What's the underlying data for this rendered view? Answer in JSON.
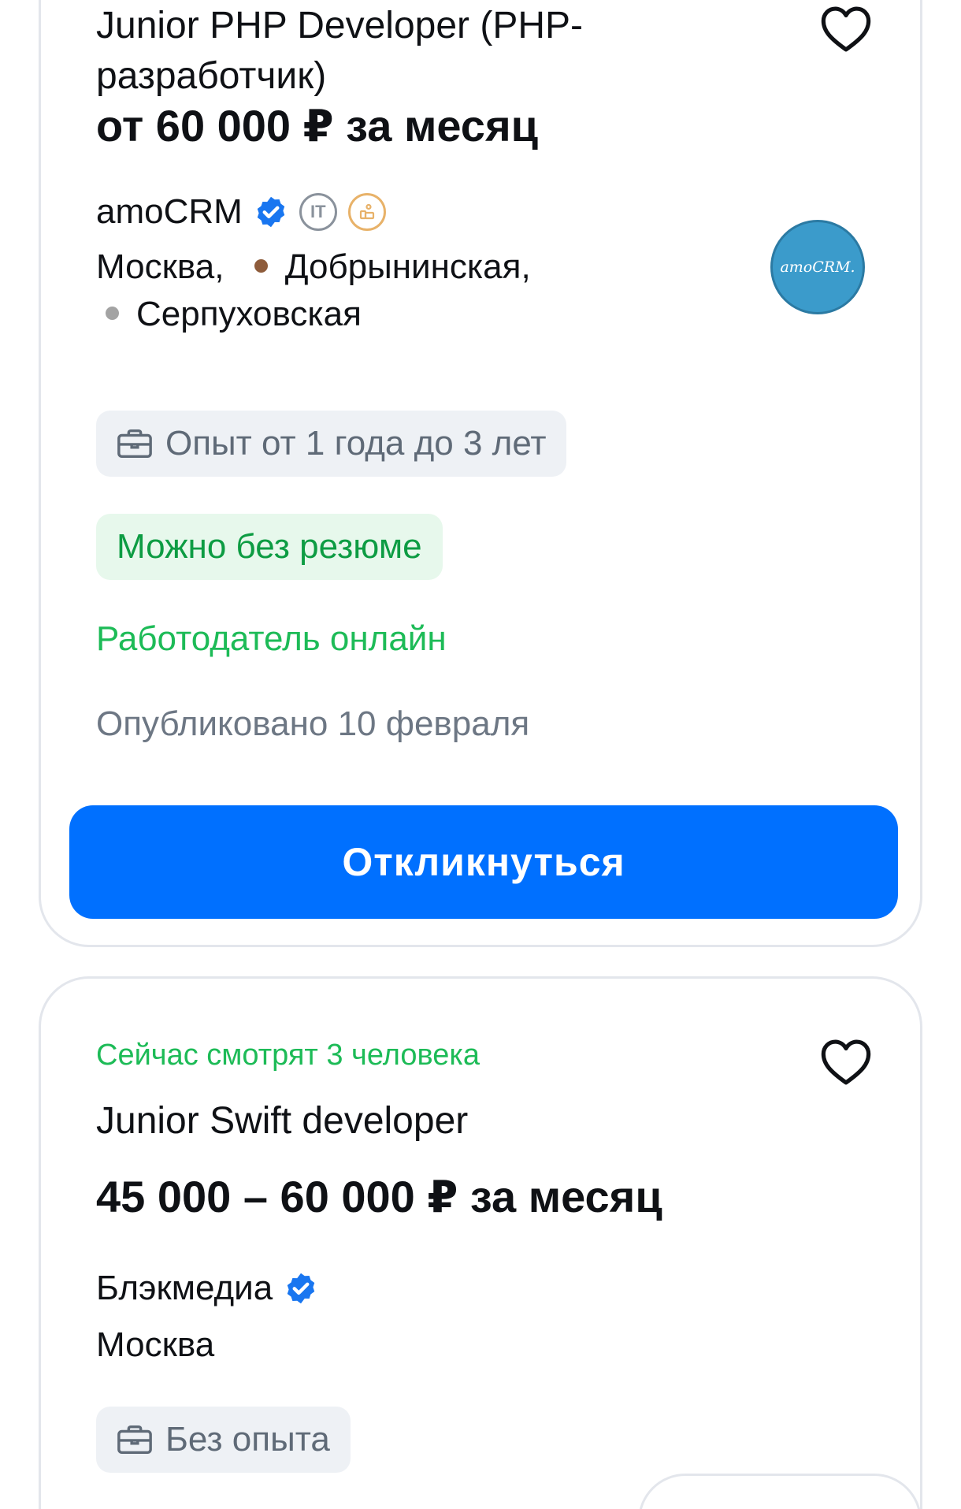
{
  "vacancies": [
    {
      "title": "Junior PHP Developer (PHP-разработчик)",
      "salary": "от 60 000 ₽ за месяц",
      "company": "amoCRM",
      "company_logo_text": "amoCRM.",
      "badges": [
        "verified-icon",
        "it-accreditation-icon",
        "trusted-employer-icon"
      ],
      "location": {
        "city": "Москва,",
        "metro": [
          {
            "name": "Добрынинская,",
            "color": "#8e5c3b"
          },
          {
            "name": "Серпуховская",
            "color": "#a3a3a3"
          }
        ]
      },
      "experience": "Опыт от 1 года до 3 лет",
      "no_resume": "Можно без резюме",
      "employer_online": "Работодатель онлайн",
      "published": "Опубликовано 10 февраля",
      "apply_label": "Откликнуться"
    },
    {
      "watching_now": "Сейчас смотрят 3 человека",
      "title": "Junior Swift developer",
      "salary": "45 000 – 60 000 ₽ за месяц",
      "company": "Блэкмедиа",
      "badges": [
        "verified-icon"
      ],
      "location": {
        "city": "Москва"
      },
      "experience": "Без опыта"
    }
  ],
  "colors": {
    "accent": "#0070ff",
    "green_text": "#1dbb57",
    "green_chip_bg": "#e7f8ec",
    "chip_bg": "#eef1f5",
    "muted_text": "#6d7784",
    "verified": "#1976f0"
  }
}
